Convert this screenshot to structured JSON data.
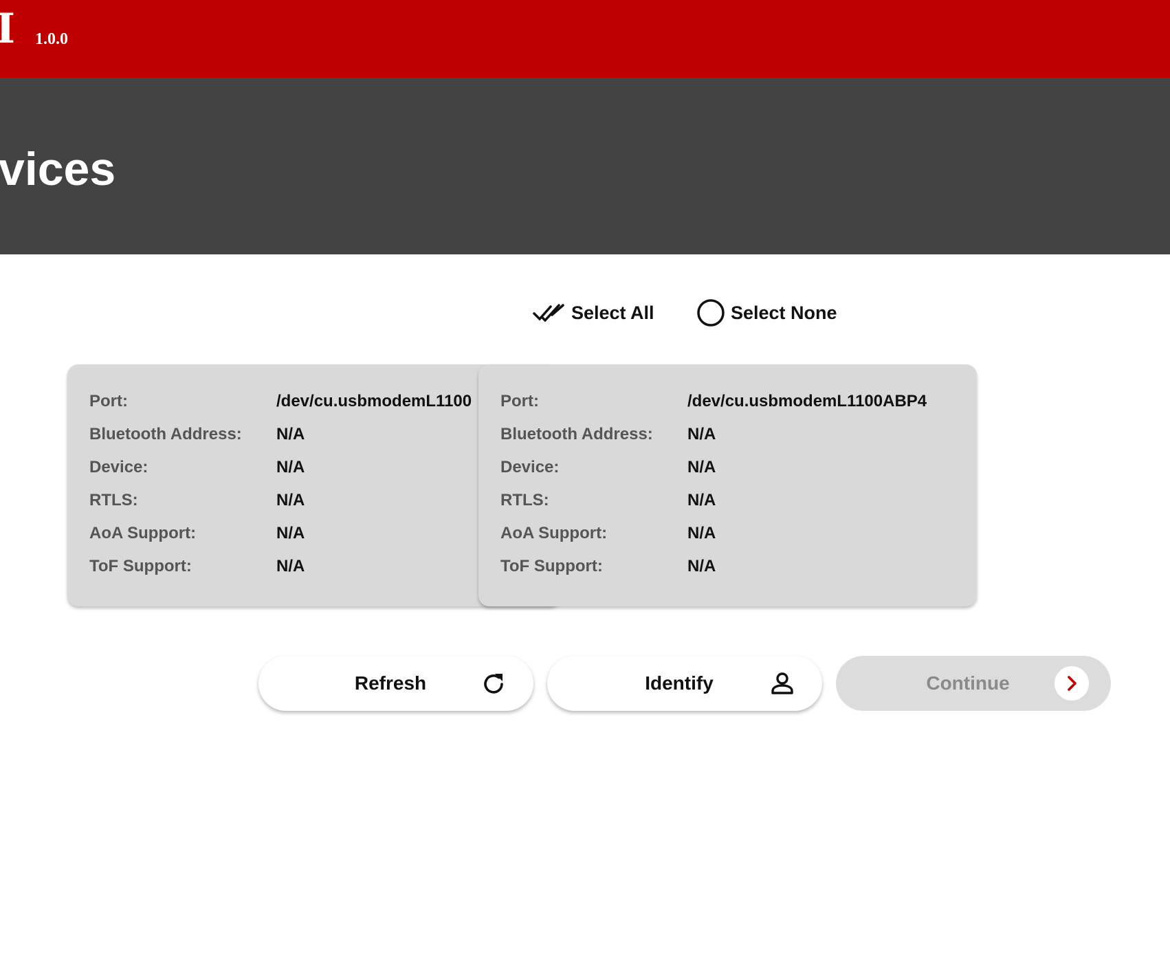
{
  "app": {
    "logo_text": "I",
    "version": "1.0.0"
  },
  "page": {
    "title": "vices"
  },
  "selection": {
    "select_all_label": "Select All",
    "select_none_label": "Select None"
  },
  "devices": [
    {
      "fields": [
        {
          "label": "Port:",
          "value": "/dev/cu.usbmodemL1100"
        },
        {
          "label": "Bluetooth Address:",
          "value": "N/A"
        },
        {
          "label": "Device:",
          "value": "N/A"
        },
        {
          "label": "RTLS:",
          "value": "N/A"
        },
        {
          "label": "AoA Support:",
          "value": "N/A"
        },
        {
          "label": "ToF Support:",
          "value": "N/A"
        }
      ]
    },
    {
      "fields": [
        {
          "label": "Port:",
          "value": "/dev/cu.usbmodemL1100ABP4"
        },
        {
          "label": "Bluetooth Address:",
          "value": "N/A"
        },
        {
          "label": "Device:",
          "value": "N/A"
        },
        {
          "label": "RTLS:",
          "value": "N/A"
        },
        {
          "label": "AoA Support:",
          "value": "N/A"
        },
        {
          "label": "ToF Support:",
          "value": "N/A"
        }
      ]
    }
  ],
  "actions": {
    "refresh_label": "Refresh",
    "refresh_icon": "refresh-icon",
    "identify_label": "Identify",
    "identify_icon": "person-icon",
    "continue_label": "Continue",
    "continue_icon": "chevron-right-icon",
    "continue_enabled": false
  },
  "colors": {
    "brand_red": "#bf0000",
    "header_gray": "#434343",
    "card_gray": "#d9d9d9",
    "disabled_button": "#dcdcdc"
  }
}
